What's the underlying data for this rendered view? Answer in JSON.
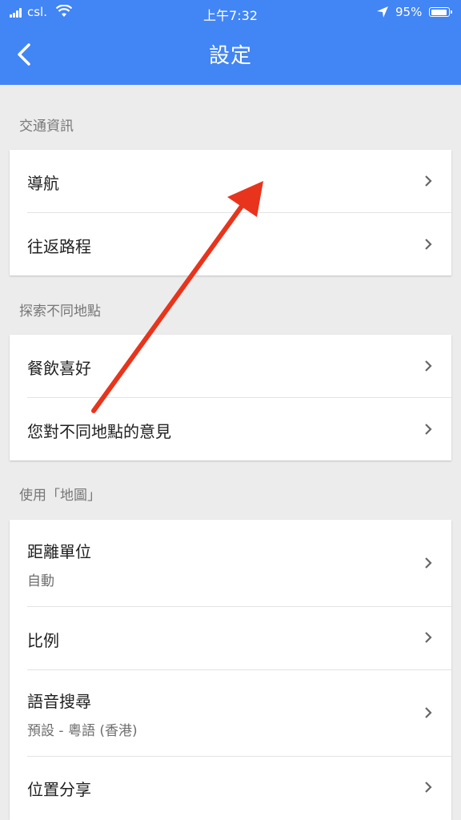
{
  "status_bar": {
    "carrier": "csl.",
    "time": "上午7:32",
    "battery": "95%"
  },
  "header": {
    "title": "設定"
  },
  "sections": {
    "traffic": {
      "label": "交通資訊",
      "items": [
        {
          "label": "導航"
        },
        {
          "label": "往返路程"
        }
      ]
    },
    "explore": {
      "label": "探索不同地點",
      "items": [
        {
          "label": "餐飲喜好"
        },
        {
          "label": "您對不同地點的意見"
        }
      ]
    },
    "maps": {
      "label": "使用「地圖」",
      "items": [
        {
          "label": "距離單位",
          "sub": "自動"
        },
        {
          "label": "比例"
        },
        {
          "label": "語音搜尋",
          "sub": "預設 - 粵語 (香港)"
        },
        {
          "label": "位置分享"
        }
      ]
    }
  },
  "colors": {
    "header": "#4285f4",
    "annotation_arrow": "#e8341c"
  }
}
